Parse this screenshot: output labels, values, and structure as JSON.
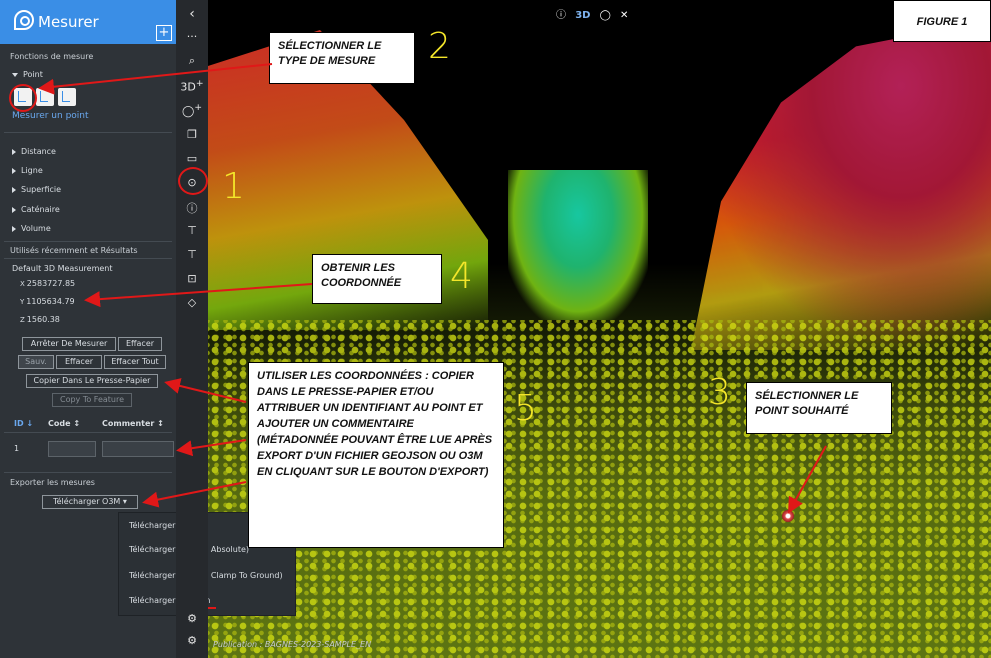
{
  "app": {
    "title": "Mesurer",
    "add_label": "+"
  },
  "panel": {
    "functions_header": "Fonctions de mesure",
    "point_label": "Point",
    "measure_point_link": "Mesurer un point",
    "types": [
      "Distance",
      "Ligne",
      "Superficie",
      "Caténaire",
      "Volume"
    ],
    "recent_header": "Utilisés récemment et Résultats",
    "default_measurement": "Default 3D Measurement",
    "x_label": "X",
    "x_value": "2583727.85",
    "y_label": "Y",
    "y_value": "1105634.79",
    "z_label": "Z",
    "z_value": "1560.38",
    "buttons": {
      "stop": "Arrêter De Mesurer",
      "clear": "Effacer",
      "save": "Sauv.",
      "clear2": "Effacer",
      "clear_all": "Effacer Tout",
      "copy": "Copier Dans Le Presse-Papier",
      "copy_feature": "Copy To Feature"
    },
    "table": {
      "col_id": "ID",
      "col_code": "Code",
      "col_comment": "Commenter",
      "row_id": "1"
    },
    "export_header": "Exporter les mesures",
    "download_button": "Télécharger O3M"
  },
  "dropdown": {
    "items": [
      "Télécharger O3M",
      "Télécharger KML (Z: Absolute)",
      "Télécharger KML (Z: Clamp To Ground)",
      "Télécharger GeoJson"
    ]
  },
  "toolbar": {
    "collapse": "‹",
    "more": "···",
    "label_3d": "3D",
    "plus": "+"
  },
  "viewer": {
    "top_label": "3D",
    "figure": "FIGURE 1",
    "publication": "Publication : BAGNES-2023-SAMPLE_EN"
  },
  "annotations": {
    "a1": "SÉLECTIONNER LE TYPE DE MESURE",
    "a2": "OBTENIR LES COORDONNÉE",
    "a3": "UTILISER LES COORDONNÉES : COPIER DANS LE PRESSE-PAPIER ET/OU ATTRIBUER UN IDENTIFIANT AU POINT ET AJOUTER UN COMMENTAIRE (MÉTADONNÉE POUVANT ÊTRE LUE APRÈS EXPORT D'UN FICHIER GEOJSON OU O3M EN CLIQUANT SUR LE BOUTON D'EXPORT)",
    "a4": "SÉLECTIONNER LE POINT SOUHAITÉ",
    "n1": "1",
    "n2": "2",
    "n3": "3",
    "n4": "4",
    "n5": "5"
  },
  "colors": {
    "accent": "#3a8ee6",
    "panel": "#2e3338",
    "annotation_red": "#e01818",
    "number_yellow": "#f4e62a"
  }
}
